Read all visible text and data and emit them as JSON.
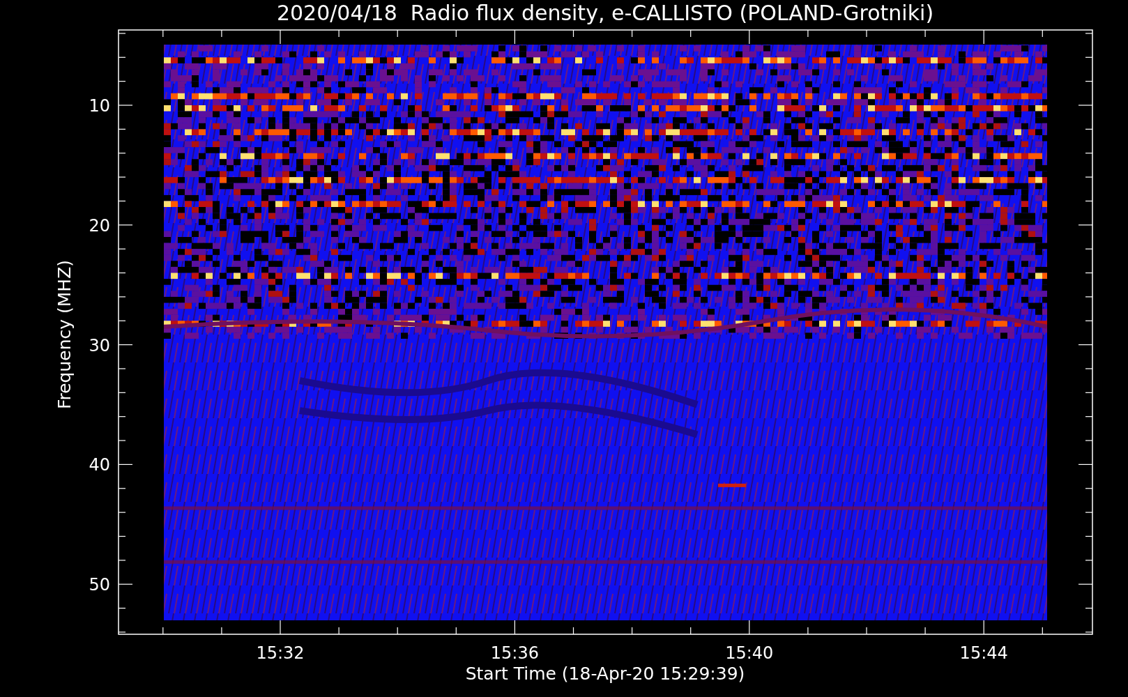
{
  "plot": {
    "title": "2020/04/18  Radio flux density, e-CALLISTO (POLAND-Grotniki)",
    "xlabel": "Start Time (18-Apr-20 15:29:39)",
    "ylabel": "Frequency (MHZ)",
    "x_tick_labels": [
      "15:32",
      "15:36",
      "15:40",
      "15:44"
    ],
    "y_tick_labels": [
      "10",
      "20",
      "30",
      "40",
      "50"
    ]
  }
}
